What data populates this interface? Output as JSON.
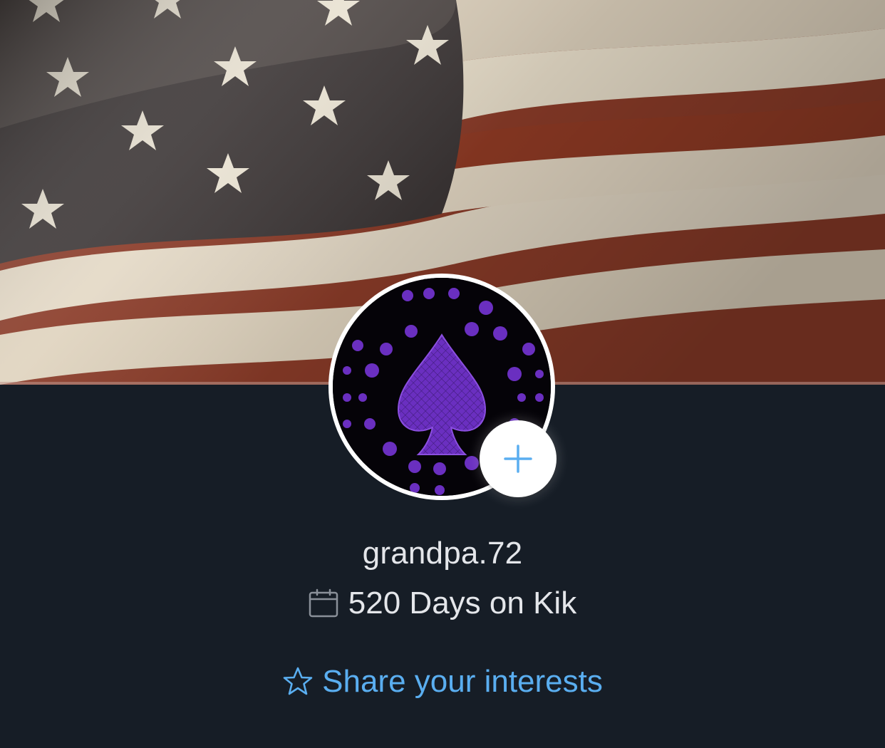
{
  "cover": {
    "image": "waving-american-flag"
  },
  "avatar": {
    "image": "purple-spade-card-suits-pattern"
  },
  "add_button": {
    "icon": "plus-icon"
  },
  "profile": {
    "username": "grandpa.72",
    "days_on_kik": "520 Days on Kik",
    "share_interests": "Share your interests"
  },
  "colors": {
    "background": "#161d26",
    "text": "#e4e6ea",
    "accent": "#5aaef0",
    "avatar_purple": "#6a2fc0"
  }
}
